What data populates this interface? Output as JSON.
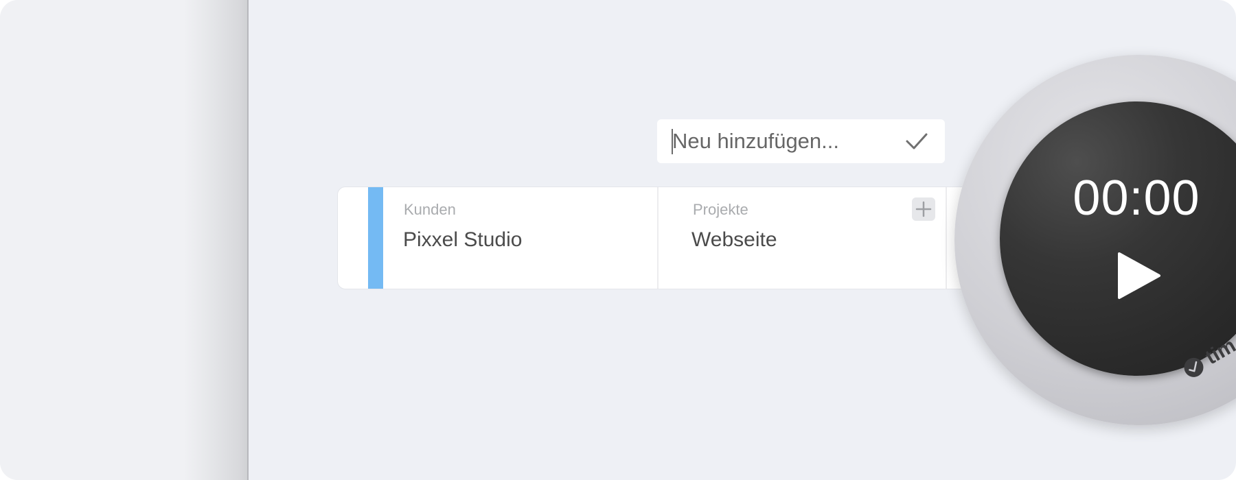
{
  "add_new": {
    "placeholder": "Neu hinzufügen...",
    "value": "",
    "confirm_icon": "checkmark-icon"
  },
  "entry": {
    "color": "#74baf3",
    "client": {
      "label": "Kunden",
      "value": "Pixxel Studio"
    },
    "project": {
      "label": "Projekte",
      "value": "Webseite",
      "add_icon": "plus-icon"
    }
  },
  "timer": {
    "time": "00:00",
    "play_icon": "play-icon"
  },
  "brand": {
    "name": "tim",
    "icon": "timer-logo-icon"
  },
  "colors": {
    "background": "#eef0f5",
    "accent": "#74baf3",
    "timer_face": "#2a2a2a"
  }
}
